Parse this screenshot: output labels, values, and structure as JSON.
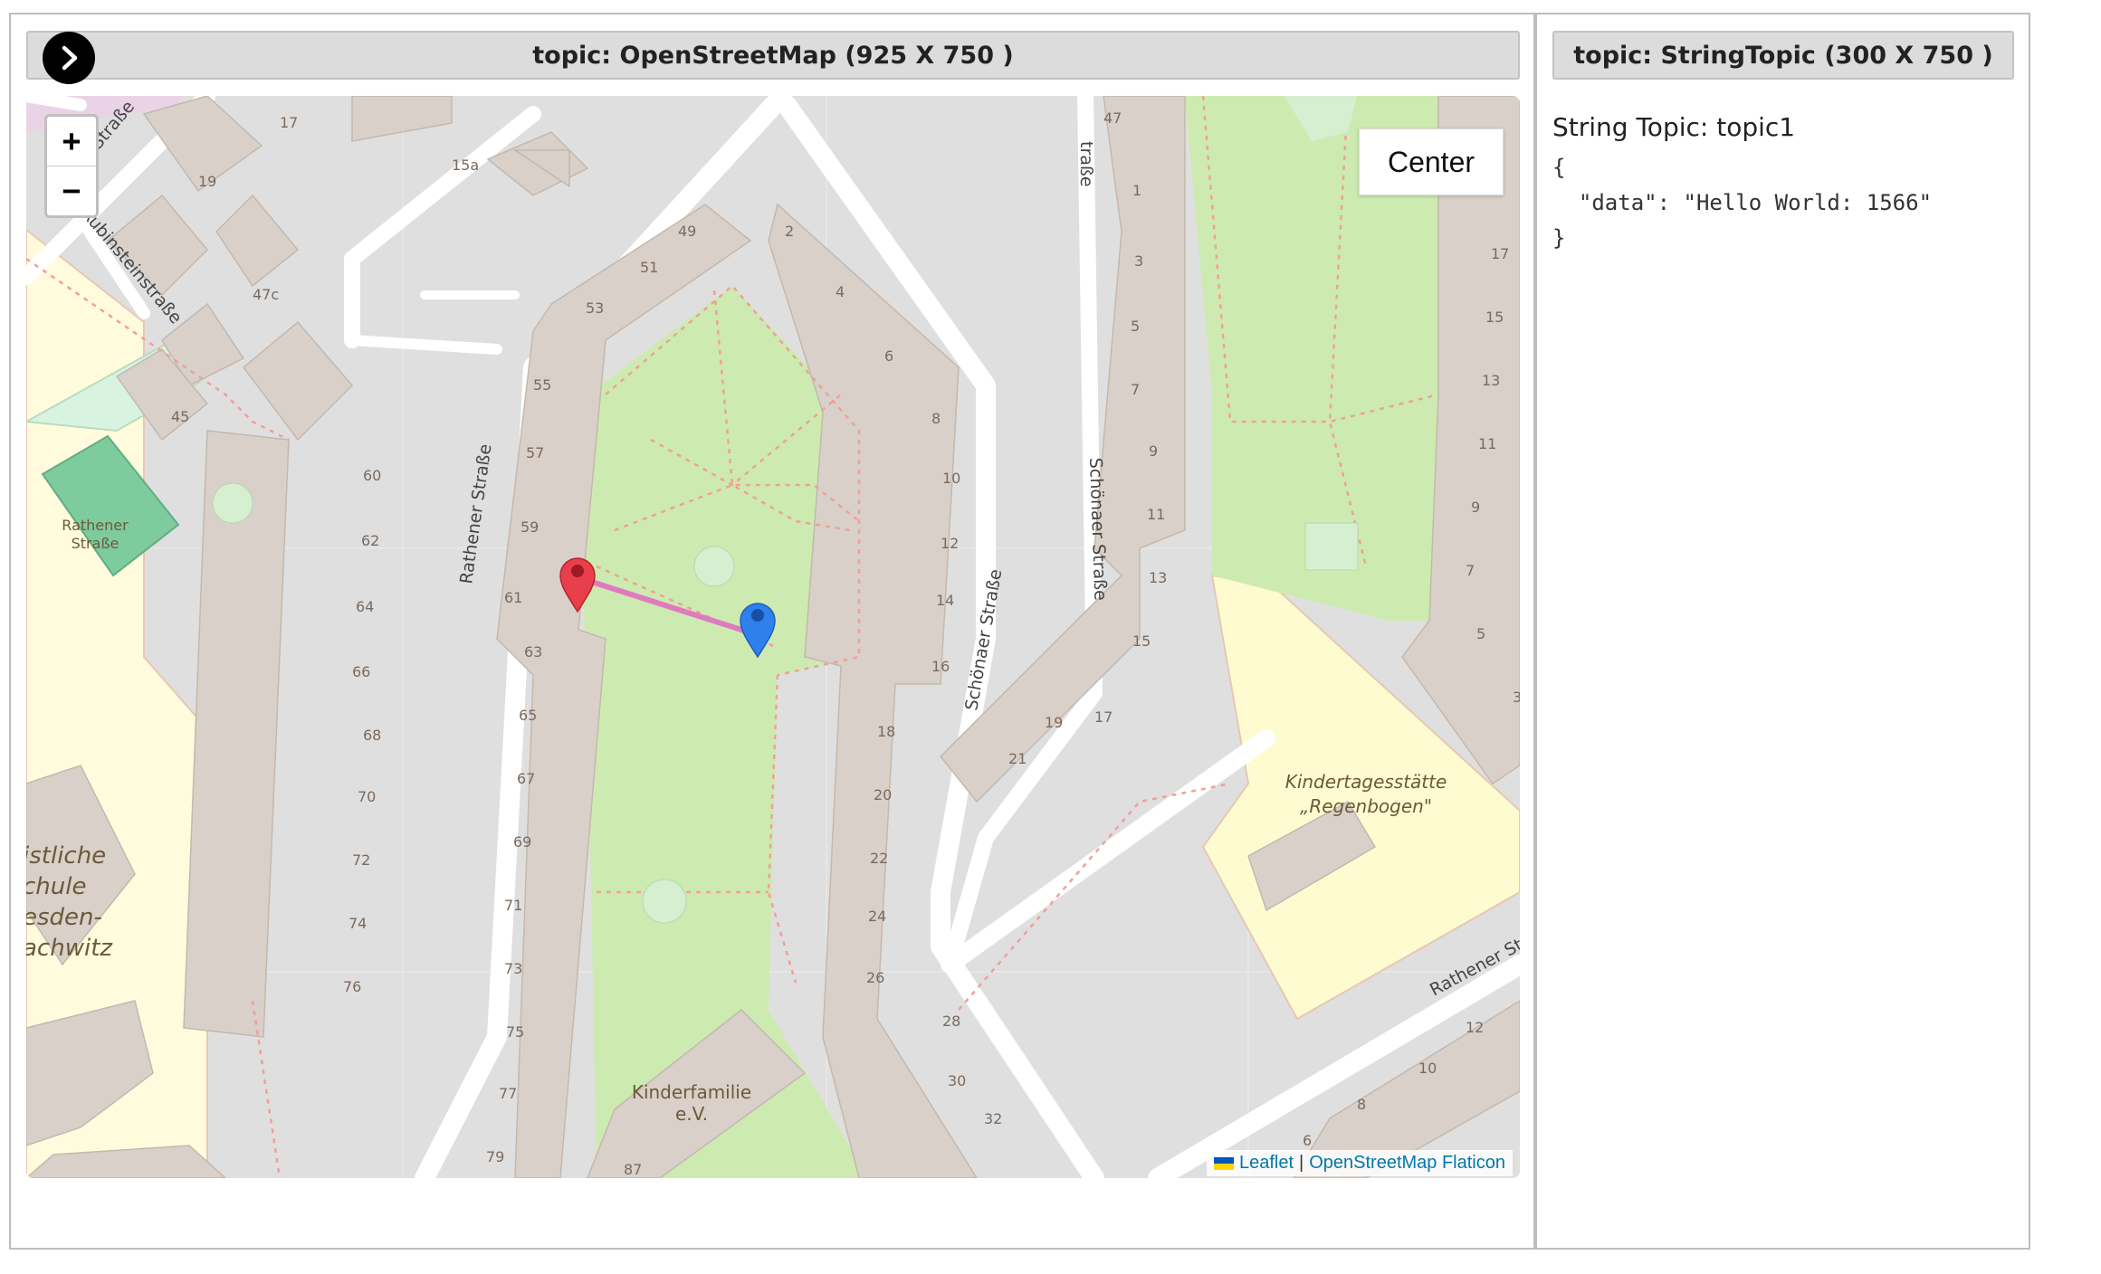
{
  "map_panel": {
    "header": "topic: OpenStreetMap (925 X 750 )",
    "toggle_icon": "chevron-right-icon",
    "zoom_in": "+",
    "zoom_out": "−",
    "center_button": "Center",
    "attribution": {
      "leaflet": "Leaflet",
      "separator": "|",
      "osm": "OpenStreetMap Flaticon"
    },
    "markers": [
      {
        "name": "red-marker",
        "color": "#e83f4d"
      },
      {
        "name": "blue-marker",
        "color": "#2f80ed"
      }
    ],
    "route_color": "#e07ac0",
    "map_labels": {
      "streets": [
        "Rubinsteinstraße",
        "Rathener Straße",
        "Schönaer Straße",
        "Schönaer Straße",
        "Rathener Str",
        "traße",
        "Straße"
      ],
      "places": [
        "Rathener Straße",
        "Kindertagesstätte „Regenbogen\"",
        "Kinderfamilie e.V.",
        "istliche chule esden- achwitz"
      ],
      "house_numbers": [
        "17",
        "19",
        "15a",
        "47c",
        "45",
        "49",
        "51",
        "53",
        "55",
        "57",
        "59",
        "61",
        "63",
        "65",
        "67",
        "69",
        "71",
        "73",
        "75",
        "77",
        "79",
        "60",
        "62",
        "64",
        "66",
        "68",
        "70",
        "72",
        "74",
        "76",
        "2",
        "4",
        "6",
        "8",
        "10",
        "12",
        "14",
        "16",
        "18",
        "20",
        "22",
        "24",
        "26",
        "28",
        "30",
        "32",
        "87",
        "47",
        "1",
        "3",
        "5",
        "7",
        "9",
        "11",
        "13",
        "15",
        "17",
        "19",
        "21",
        "17",
        "15",
        "13",
        "11",
        "9",
        "7",
        "5",
        "3",
        "14",
        "12",
        "10",
        "8",
        "6"
      ]
    }
  },
  "string_panel": {
    "header": "topic: StringTopic (300 X 750 )",
    "title": "String Topic: topic1",
    "json_text": "{\n  \"data\": \"Hello World: 1566\"\n}"
  }
}
